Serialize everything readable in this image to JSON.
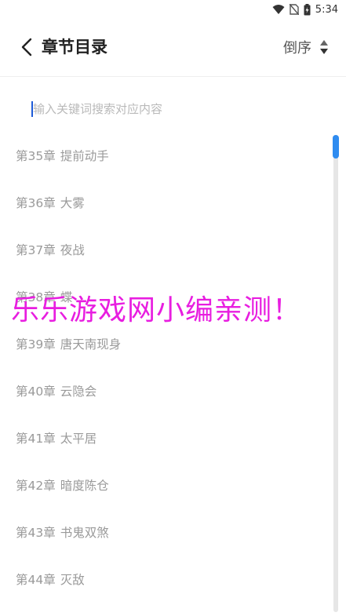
{
  "status_bar": {
    "time": "5:34",
    "icons": [
      "wifi-icon",
      "no-sim-icon",
      "battery-charging-icon"
    ]
  },
  "header": {
    "title": "章节目录",
    "sort_label": "倒序",
    "back_icon": "chevron-left-icon",
    "sort_icon": "sort-updown-icon"
  },
  "search": {
    "placeholder": "输入关键词搜索对应内容",
    "value": ""
  },
  "chapters": [
    {
      "num": "第35章",
      "title": "提前动手"
    },
    {
      "num": "第36章",
      "title": "大雾"
    },
    {
      "num": "第37章",
      "title": "夜战"
    },
    {
      "num": "第38章",
      "title": "蝶"
    },
    {
      "num": "第39章",
      "title": "唐天南现身"
    },
    {
      "num": "第40章",
      "title": "云隐会"
    },
    {
      "num": "第41章",
      "title": "太平居"
    },
    {
      "num": "第42章",
      "title": "暗度陈仓"
    },
    {
      "num": "第43章",
      "title": "书鬼双煞"
    },
    {
      "num": "第44章",
      "title": "灭敌"
    }
  ],
  "watermark": {
    "text": "乐乐游戏网小编亲测！",
    "color": "#e81ee0"
  },
  "colors": {
    "scroll_thumb": "#2f8cf0",
    "chapter_text": "#9a9a9a"
  }
}
